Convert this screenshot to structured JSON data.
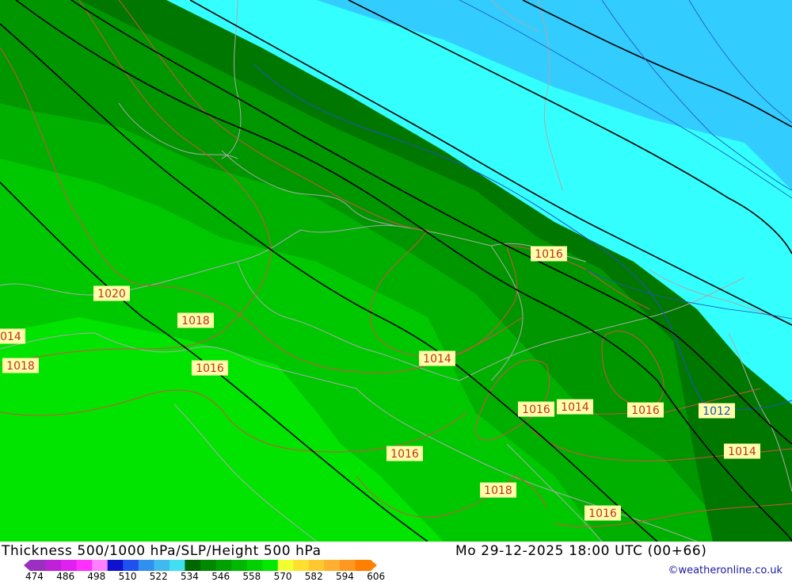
{
  "map": {
    "pressure_labels": [
      {
        "text": "1014",
        "color": "red"
      },
      {
        "text": "1020",
        "color": "red"
      },
      {
        "text": "1018",
        "color": "red"
      },
      {
        "text": "1018",
        "color": "red"
      },
      {
        "text": "1016",
        "color": "red"
      },
      {
        "text": "1014",
        "color": "red"
      },
      {
        "text": "1016",
        "color": "red"
      },
      {
        "text": "1014",
        "color": "red"
      },
      {
        "text": "1016",
        "color": "red"
      },
      {
        "text": "1012",
        "color": "blue"
      },
      {
        "text": "1016",
        "color": "red"
      },
      {
        "text": "1014",
        "color": "red"
      },
      {
        "text": "1018",
        "color": "red"
      },
      {
        "text": "1016",
        "color": "red"
      },
      {
        "text": "1016",
        "color": "red"
      }
    ],
    "colors": {
      "green_1": "#00e400",
      "green_2": "#00c800",
      "green_3": "#00b000",
      "green_4": "#009600",
      "green_5": "#007800",
      "cyan": "#33ffff",
      "sky": "#33ccff",
      "border": "#aaaaaa",
      "slp_contour": "#d05040",
      "slp_contour_low": "#2050c0",
      "height_contour": "#000000",
      "label_bg": "#ffffaa"
    }
  },
  "footer": {
    "title_left": "Thickness 500/1000 hPa/SLP/Height 500 hPa",
    "title_right": "Mo 29-12-2025 18:00 UTC (00+66)",
    "credit": "©weatheronline.co.uk",
    "legend_ticks": [
      "474",
      "486",
      "498",
      "510",
      "522",
      "534",
      "546",
      "558",
      "570",
      "582",
      "594",
      "606"
    ],
    "legend_colors": [
      "#9b2fc0",
      "#c020d8",
      "#e020f0",
      "#ff30ff",
      "#ff80ff",
      "#1010d0",
      "#2050f0",
      "#3090f0",
      "#40b8f0",
      "#40e0f0",
      "#006600",
      "#008800",
      "#00a000",
      "#00b800",
      "#00d000",
      "#00e800",
      "#f0ff30",
      "#ffe030",
      "#ffc830",
      "#ffb030",
      "#ff9820",
      "#ff8000"
    ]
  }
}
